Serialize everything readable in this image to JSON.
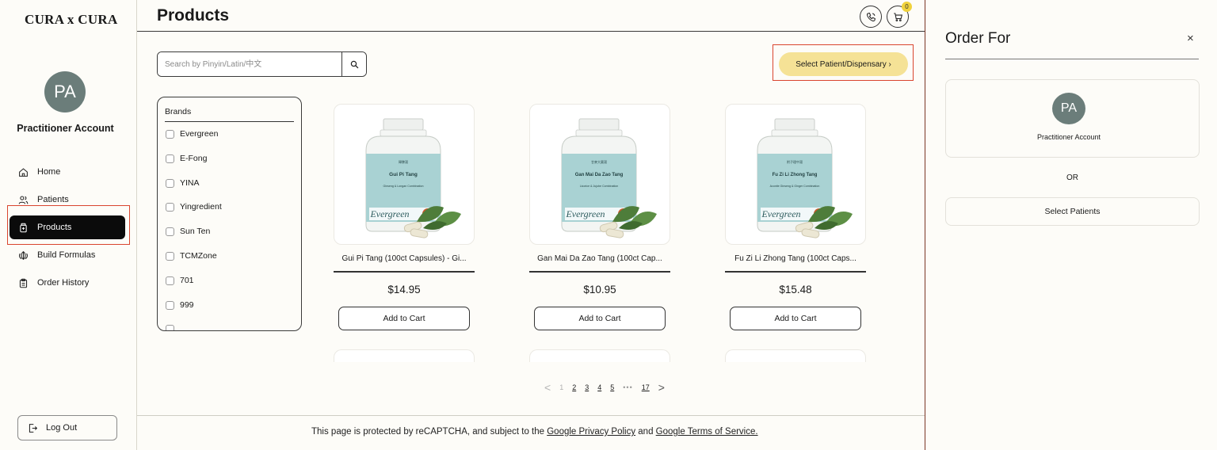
{
  "brand": {
    "logo": "CURA x CURA"
  },
  "account": {
    "initials": "PA",
    "name": "Practitioner Account"
  },
  "nav": {
    "home": "Home",
    "patients": "Patients",
    "products": "Products",
    "build_formulas": "Build Formulas",
    "order_history": "Order History"
  },
  "logout_label": "Log Out",
  "header": {
    "title": "Products",
    "cart_count": "0"
  },
  "search": {
    "placeholder": "Search by Pinyin/Latin/中文"
  },
  "select_button": "Select Patient/Dispensary ›",
  "brands": {
    "title": "Brands",
    "items": [
      "Evergreen",
      "E-Fong",
      "YINA",
      "Yingredient",
      "Sun Ten",
      "TCMZone",
      "701",
      "999"
    ]
  },
  "products": [
    {
      "label_cn": "歸脾湯",
      "label_en": "Gui Pi Tang",
      "label_sub": "Ginseng & Longan Combination",
      "name": "Gui Pi Tang (100ct Capsules) - Gi...",
      "price": "$14.95",
      "button": "Add to Cart"
    },
    {
      "label_cn": "甘麥大棗湯",
      "label_en": "Gan Mai Da Zao Tang",
      "label_sub": "Licorice & Jujube Combination",
      "name": "Gan Mai Da Zao Tang (100ct Cap...",
      "price": "$10.95",
      "button": "Add to Cart"
    },
    {
      "label_cn": "附子理中湯",
      "label_en": "Fu Zi Li Zhong Tang",
      "label_sub": "Aconite Ginseng & Ginger Combination",
      "name": "Fu Zi Li Zhong Tang (100ct Caps...",
      "price": "$15.48",
      "button": "Add to Cart"
    }
  ],
  "product_brand_mark": "Evergreen",
  "pagination": {
    "prev": "<",
    "next": ">",
    "pages": [
      "1",
      "2",
      "3",
      "4",
      "5"
    ],
    "ellipsis": "•••",
    "last": "17"
  },
  "footer": {
    "text_before": "This page is protected by reCAPTCHA, and subject to the ",
    "privacy_link": "Google Privacy Policy",
    "text_middle": " and ",
    "terms_link": "Google Terms of Service."
  },
  "panel": {
    "title": "Order For",
    "close": "×",
    "initials": "PA",
    "account_name": "Practitioner Account",
    "or": "OR",
    "select_patients": "Select Patients"
  }
}
